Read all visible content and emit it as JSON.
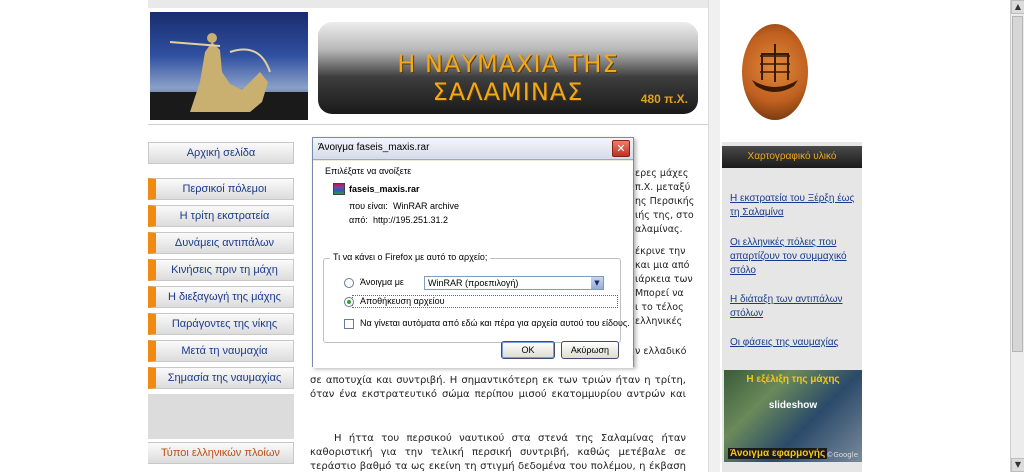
{
  "site": {
    "banner_title": "Η ΝΑΥΜΑΧΙΑ ΤΗΣ ΣΑΛΑΜΙΝΑΣ",
    "banner_subtitle": "480 π.Χ."
  },
  "nav": {
    "items": [
      {
        "label": "Αρχική σελίδα"
      },
      {
        "label": "Περσικοί πόλεμοι"
      },
      {
        "label": "Η τρίτη εκστρατεία"
      },
      {
        "label": "Δυνάμεις αντιπάλων"
      },
      {
        "label": "Κινήσεις πριν τη μάχη"
      },
      {
        "label": "Η διεξαγωγή της μάχης"
      },
      {
        "label": "Παράγοντες της νίκης"
      },
      {
        "label": "Μετά τη ναυμαχία"
      },
      {
        "label": "Σημασία της ναυμαχίας"
      }
    ],
    "bottom_item": "Τύποι ελληνικών πλοίων"
  },
  "right_panel": {
    "heading": "Χαρτογραφικό υλικό",
    "links": [
      {
        "label": "Η εκστρατεία του Ξέρξη έως τη Σαλαμίνα"
      },
      {
        "label": "Οι ελληνικές πόλεις που απαρτίζουν τον συμμαχικό στόλο"
      },
      {
        "label": "Η διάταξη των αντιπάλων στόλων"
      },
      {
        "label": "Οι φάσεις της ναυμαχίας"
      }
    ],
    "slideshow": {
      "title": "Η εξέλιξη της μάχης",
      "label": "slideshow",
      "action": "Άνοιγμα εφαρμογής",
      "credit": "©Google"
    }
  },
  "article": {
    "fragments": [
      "ερες μάχες",
      "π.Χ. μεταξύ",
      "ης Περσικής",
      "ιής της, στο",
      "αλαμίνας.",
      "έκρινε την",
      "και μια από",
      "ιάρκεια των",
      "Μπορεί να",
      "ι το τέλος",
      "ελληνικές",
      "ν ελλαδικό"
    ],
    "paragraph1": "σε αποτυχία και συντριβή. Η σημαντικότερη εκ των τριών ήταν η τρίτη, όταν ένα εκστρατευτικό σώμα περίπου μισού εκατομμυρίου αντρών και χιλίων διακοσίων πολεμικών πλοίων κινήθηκε εναντίον των ελληνικών πόλεων υπό την ηγεσία του ίδιου του Πέρση βασιλιά Ξέρξη.",
    "paragraph2": "Η ήττα του περσικού ναυτικού στα στενά της Σαλαμίνας ήταν καθοριστική για την τελική περσική συντριβή, καθώς μετέβαλε σε τεράστιο βαθμό τα ως εκείνη τη στιγμή δεδομένα του πολέμου, η έκβαση του οποίου έγειρε δραματικά"
  },
  "dialog": {
    "title": "Άνοιγμα faseis_maxis.rar",
    "prompt": "Επιλέξατε να ανοίξετε",
    "filename": "faseis_maxis.rar",
    "type_label": "που είναι:",
    "type_value": "WinRAR archive",
    "from_label": "από:",
    "from_value": "http://195.251.31.2",
    "group_label": "Τι να κάνει ο Firefox  με αυτό το αρχείο;",
    "open_with_label": "Άνοιγμα με",
    "open_with_value": "WinRAR (προεπιλογή)",
    "save_label": "Αποθήκευση αρχείου",
    "auto_label": "Να γίνεται αυτόματα από εδώ και πέρα για αρχεία αυτού του είδους.",
    "ok_label": "OK",
    "cancel_label": "Ακύρωση",
    "selected_option": "save"
  },
  "scrollbar": {
    "up": "▲",
    "down": "▼"
  },
  "colors": {
    "accent_orange": "#f08a10",
    "banner_text": "#f2a818",
    "link_blue": "#1a3a8a"
  }
}
